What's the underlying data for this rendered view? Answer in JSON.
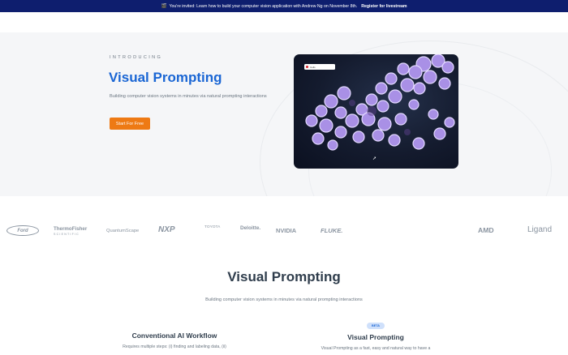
{
  "announcement": {
    "emoji": "🎬",
    "text": "You're invited: Learn how to build your computer vision application with Andrew Ng on November 8th.",
    "link": "Register for livestream"
  },
  "hero": {
    "eyebrow": "INTRODUCING",
    "title": "Visual Prompting",
    "subtitle": "Building computer vision systems in minutes via natural prompting interactions",
    "cta": "Start For Free"
  },
  "media": {
    "chip_text": "Cells",
    "icon": "cursor-icon"
  },
  "logos": [
    "Ford",
    "ThermoFisher",
    "SCIENTIFIC",
    "QuantumScape",
    "NXP",
    "TOYOTA",
    "Deloitte.",
    "NVIDIA",
    "FLUKE.",
    "AMD",
    "Ligand"
  ],
  "section": {
    "title": "Visual Prompting",
    "subtitle": "Building computer vision systems in minutes via natural prompting interactions"
  },
  "columns": {
    "left": {
      "title": "Conventional AI Workflow",
      "text": "Requires multiple steps: (i) finding and labeling data, (ii)"
    },
    "right": {
      "badge": "BETA",
      "title": "Visual Prompting",
      "text": "Visual Prompting as a fast, easy and natural way to have a"
    }
  },
  "colors": {
    "accent": "#1a66d4",
    "cta": "#ee7a14",
    "banner": "#0e1e6e"
  }
}
